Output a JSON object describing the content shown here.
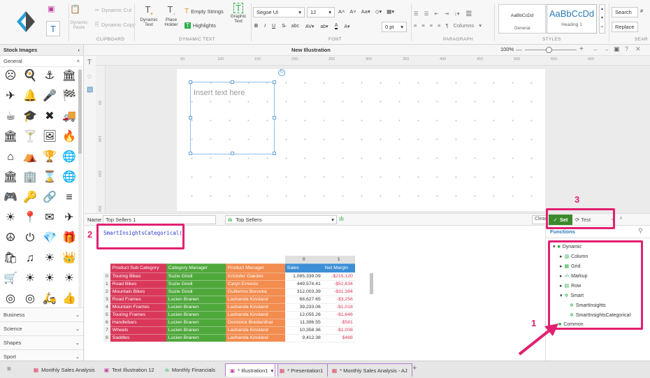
{
  "ribbon": {
    "dynamic_cut": "Dynamic Cut",
    "dynamic_paste": "Dynamic Paste",
    "dynamic_copy": "Dynamic Copy",
    "clipboard": "CLIPBOARD",
    "dynamic_text": "Dynamic Text",
    "place_holder": "Place Holder",
    "empty_strings": "Empty Strings",
    "highlights": "Highlights",
    "graphic_text": "Graphic Text",
    "dynamic_text_group": "DYNAMIC TEXT",
    "font_name": "Segoe UI",
    "font_size": "12",
    "spacing": "0 pt",
    "font_group": "FONT",
    "columns": "Columns",
    "paragraph_group": "PARAGRAPH",
    "style1_sample": "AaBbCcDd",
    "style1_name": "General",
    "style2_sample": "AaBbCcDd",
    "style2_name": "Heading 1",
    "styles_group": "STYLES",
    "search": "Search",
    "replace": "Replace",
    "search_group": "SEAR"
  },
  "sidebar": {
    "title": "Stock Images",
    "subtitle": "General",
    "icons": [
      "☹",
      "🍳",
      "⚓",
      "🏛",
      "✈",
      "🔔",
      "🎤",
      "🏁",
      "☕",
      "🎓",
      "✖",
      "🚚",
      "🏛",
      "🍸",
      "🖼",
      "🔥",
      "⌂",
      "⛺",
      "🏆",
      "🌐",
      "🏛",
      "🏢",
      "⌛",
      "🌐",
      "🎮",
      "🔑",
      "🔗",
      "≡",
      "☀",
      "📍",
      "✉",
      "✈",
      "☮",
      "⏻",
      "💎",
      "🎁",
      "🛍",
      "♫",
      "☀",
      "👑",
      "🛒",
      "☀",
      "☀",
      "☀",
      "◎",
      "◎",
      "🛵",
      "👍",
      "👍",
      "👍",
      "☂",
      "▌"
    ],
    "categories": [
      "Business",
      "Science",
      "Shapes",
      "Sport"
    ]
  },
  "canvas": {
    "title": "New Illustration",
    "zoom": "100%",
    "placeholder": "Insert text here"
  },
  "ruler_marks": [
    "50",
    "100",
    "150",
    "200",
    "250",
    "300",
    "350",
    "400",
    "450",
    "500",
    "550",
    "600"
  ],
  "ruler_v_marks": [
    "50",
    "100",
    "150",
    "200"
  ],
  "formula": {
    "name_label": "Name",
    "name_value": "Top Sellers 1",
    "dataset": "Top Sellers",
    "clear": "Clear",
    "set": "Set",
    "test": "Test",
    "expression": "SmartInsightsCategorical()"
  },
  "grid": {
    "headers": [
      "Product Sub Category",
      "Category Manager",
      "Product Manager",
      "Sales",
      "Net Margin"
    ],
    "col_index": [
      "0",
      "1"
    ],
    "rows": [
      [
        "0",
        "Touring Bikes",
        "Suzie Gindi",
        "Kristofer Oakden",
        "1,085,339.09",
        "-$215,120"
      ],
      [
        "1",
        "Road Bikes",
        "Suzie Gindi",
        "Caryn Ernesto",
        "449,574.41",
        "-$52,634"
      ],
      [
        "2",
        "Mountain Bikes",
        "Suzie Gindi",
        "Guillermo Boruvka",
        "312,003.39",
        "-$31,384"
      ],
      [
        "3",
        "Road Frames",
        "Lucien Branen",
        "Lashanda Kinsland",
        "68,627.65",
        "-$3,256"
      ],
      [
        "4",
        "Mountain Frames",
        "Lucien Branen",
        "Lashanda Kinsland",
        "39,233.06",
        "-$1,018"
      ],
      [
        "5",
        "Touring Frames",
        "Lucien Branen",
        "Lashanda Kinsland",
        "12,055.26",
        "-$1,646"
      ],
      [
        "6",
        "Handlebars",
        "Lucien Branen",
        "Dominick Breidenthal",
        "11,396.55",
        "-$581"
      ],
      [
        "7",
        "Wheels",
        "Lucien Branen",
        "Lashanda Kinsland",
        "10,358.36",
        "-$1,008"
      ],
      [
        "8",
        "Saddles",
        "Lucien Branen",
        "Lashanda Kinsland",
        "9,412.38",
        "$488"
      ]
    ]
  },
  "functions": {
    "title": "Functions",
    "items": [
      "Dynamic",
      "Column",
      "Grid",
      "Markup",
      "Row",
      "Smart",
      "SmartInsights",
      "SmartInsightsCategorical",
      "Common"
    ]
  },
  "callouts": {
    "n1": "1",
    "n2": "2",
    "n3": "3"
  },
  "tabs": [
    "Monthly Sales Analysis",
    "Text Illustration 12",
    "Monthly Financials",
    "* Illustration1",
    "* Presentation1",
    "* Monthly Sales Analysis - AJ"
  ],
  "colors": {
    "cat_col": "#d9385a",
    "mgr_col": "#4fa83c",
    "pm_col": "#f28c4f",
    "sales_head": "#3c8fd6",
    "margin_head": "#3c8fd6",
    "accent": "#e22070",
    "set_green": "#3a8a2c"
  }
}
